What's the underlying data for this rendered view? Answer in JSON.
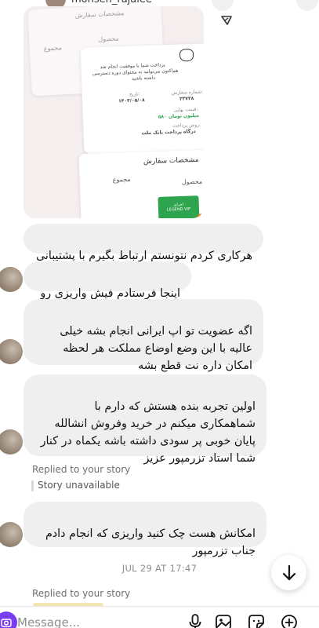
{
  "header": {
    "username": "mohsen_rajaiee"
  },
  "shared_image": {
    "back_card_title": "مشخصات سفارش",
    "back_card_subtotal": "مجموع",
    "back_card_total": "محصول",
    "receipt_line1": "پرداخت شما با موفقیت انجام شد",
    "receipt_line2": "هم‌اکنون می‌توانید به محتوای دوره دسترسی",
    "receipt_line3": "داشته باشید",
    "order_number_label": "شماره سفارش:",
    "order_number": "۲۳۷۳۸",
    "date_label": "تاریخ:",
    "date": "۱۴۰۳/۰۵/۰۸",
    "final_price_label": "قیمت نهایی:",
    "final_price": "۵۸۰ میلیون تومان",
    "payment_method_label": "روش پرداخت:",
    "payment_method": "درگاه پرداخت بانک ملت",
    "order_details_title": "مشخصات سفارش",
    "order_product_label": "محصول",
    "order_total_label": "مجموع",
    "product_badge_line1": "اجرای",
    "product_badge_line2": "LEGEND VIP"
  },
  "messages": [
    {
      "id": "m1",
      "text": "هرکاری کردم نتونستم ارتباط بگیرم با پشتیبانی"
    },
    {
      "id": "m2",
      "text": "اینجا فرستادم فیش واریزی رو"
    },
    {
      "id": "m3",
      "text": "اگه عضویت تو اپ ایرانی انجام  بشه خیلی\nعالیه با این وضع اوضاع مملکت هر لحظه\nامکان داره نت قطع بشه"
    },
    {
      "id": "m4",
      "text": "اولین تجربه بنده هستش که دارم با\nشماهمکاری میکنم در خرید وفروش انشالله\nپایان خوبی پر سودی داشته باشه یکماه در کنار\nشما استاد تزرمپور عزیز"
    },
    {
      "id": "m5",
      "text": "امکانش هست چک کنید واریزی که انجام دادم\nجناب تزرمپور"
    }
  ],
  "story_reply": {
    "replied_label": "Replied to your story",
    "unavailable_label": "Story unavailable"
  },
  "timestamp": "JUL 29 AT 17:47",
  "bottom_reply": {
    "replied_label": "Replied to your story"
  },
  "composer": {
    "placeholder": "Message...",
    "icons": [
      "camera-icon",
      "microphone-icon",
      "gallery-icon",
      "sticker-icon",
      "add-icon"
    ]
  },
  "colors": {
    "bubble_bg": "#efefef",
    "accent_purple": "#7a3cf3",
    "meta_text": "#6e6e6e",
    "green_badge": "#2ea44f"
  }
}
